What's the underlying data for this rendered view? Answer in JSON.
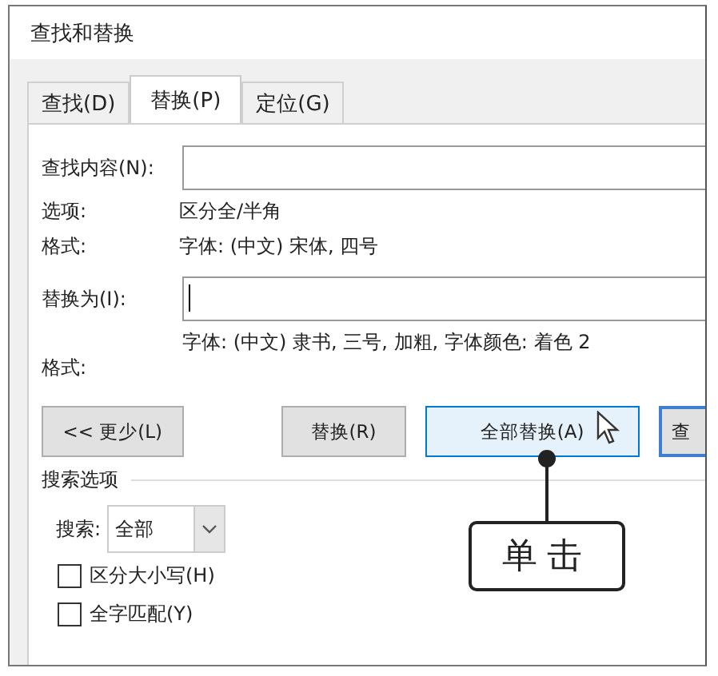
{
  "window": {
    "title": "查找和替换"
  },
  "tabs": [
    {
      "label": "查找(D)",
      "selected": false
    },
    {
      "label": "替换(P)",
      "selected": true
    },
    {
      "label": "定位(G)",
      "selected": false
    }
  ],
  "find": {
    "label": "查找内容(N):",
    "options_label": "选项:",
    "options_value": "区分全/半角",
    "format_label": "格式:",
    "format_value": "字体: (中文) 宋体, 四号"
  },
  "replace": {
    "label": "替换为(I):",
    "format_label": "格式:",
    "format_value": "字体: (中文) 隶书, 三号, 加粗, 字体颜色: 着色 2"
  },
  "buttons": [
    {
      "label": "<< 更少(L)",
      "selected": false
    },
    {
      "label": "替换(R)",
      "selected": false
    },
    {
      "label": "全部替换(A)",
      "selected": true
    },
    {
      "label": "查",
      "selected": false
    }
  ],
  "search_options": {
    "title": "搜索选项",
    "search_label": "搜索:",
    "search_value": "全部",
    "checkboxes": [
      {
        "label": "区分大小写(H)",
        "checked": false
      },
      {
        "label": "全字匹配(Y)",
        "checked": false
      }
    ]
  },
  "callout": {
    "text": "单击"
  }
}
